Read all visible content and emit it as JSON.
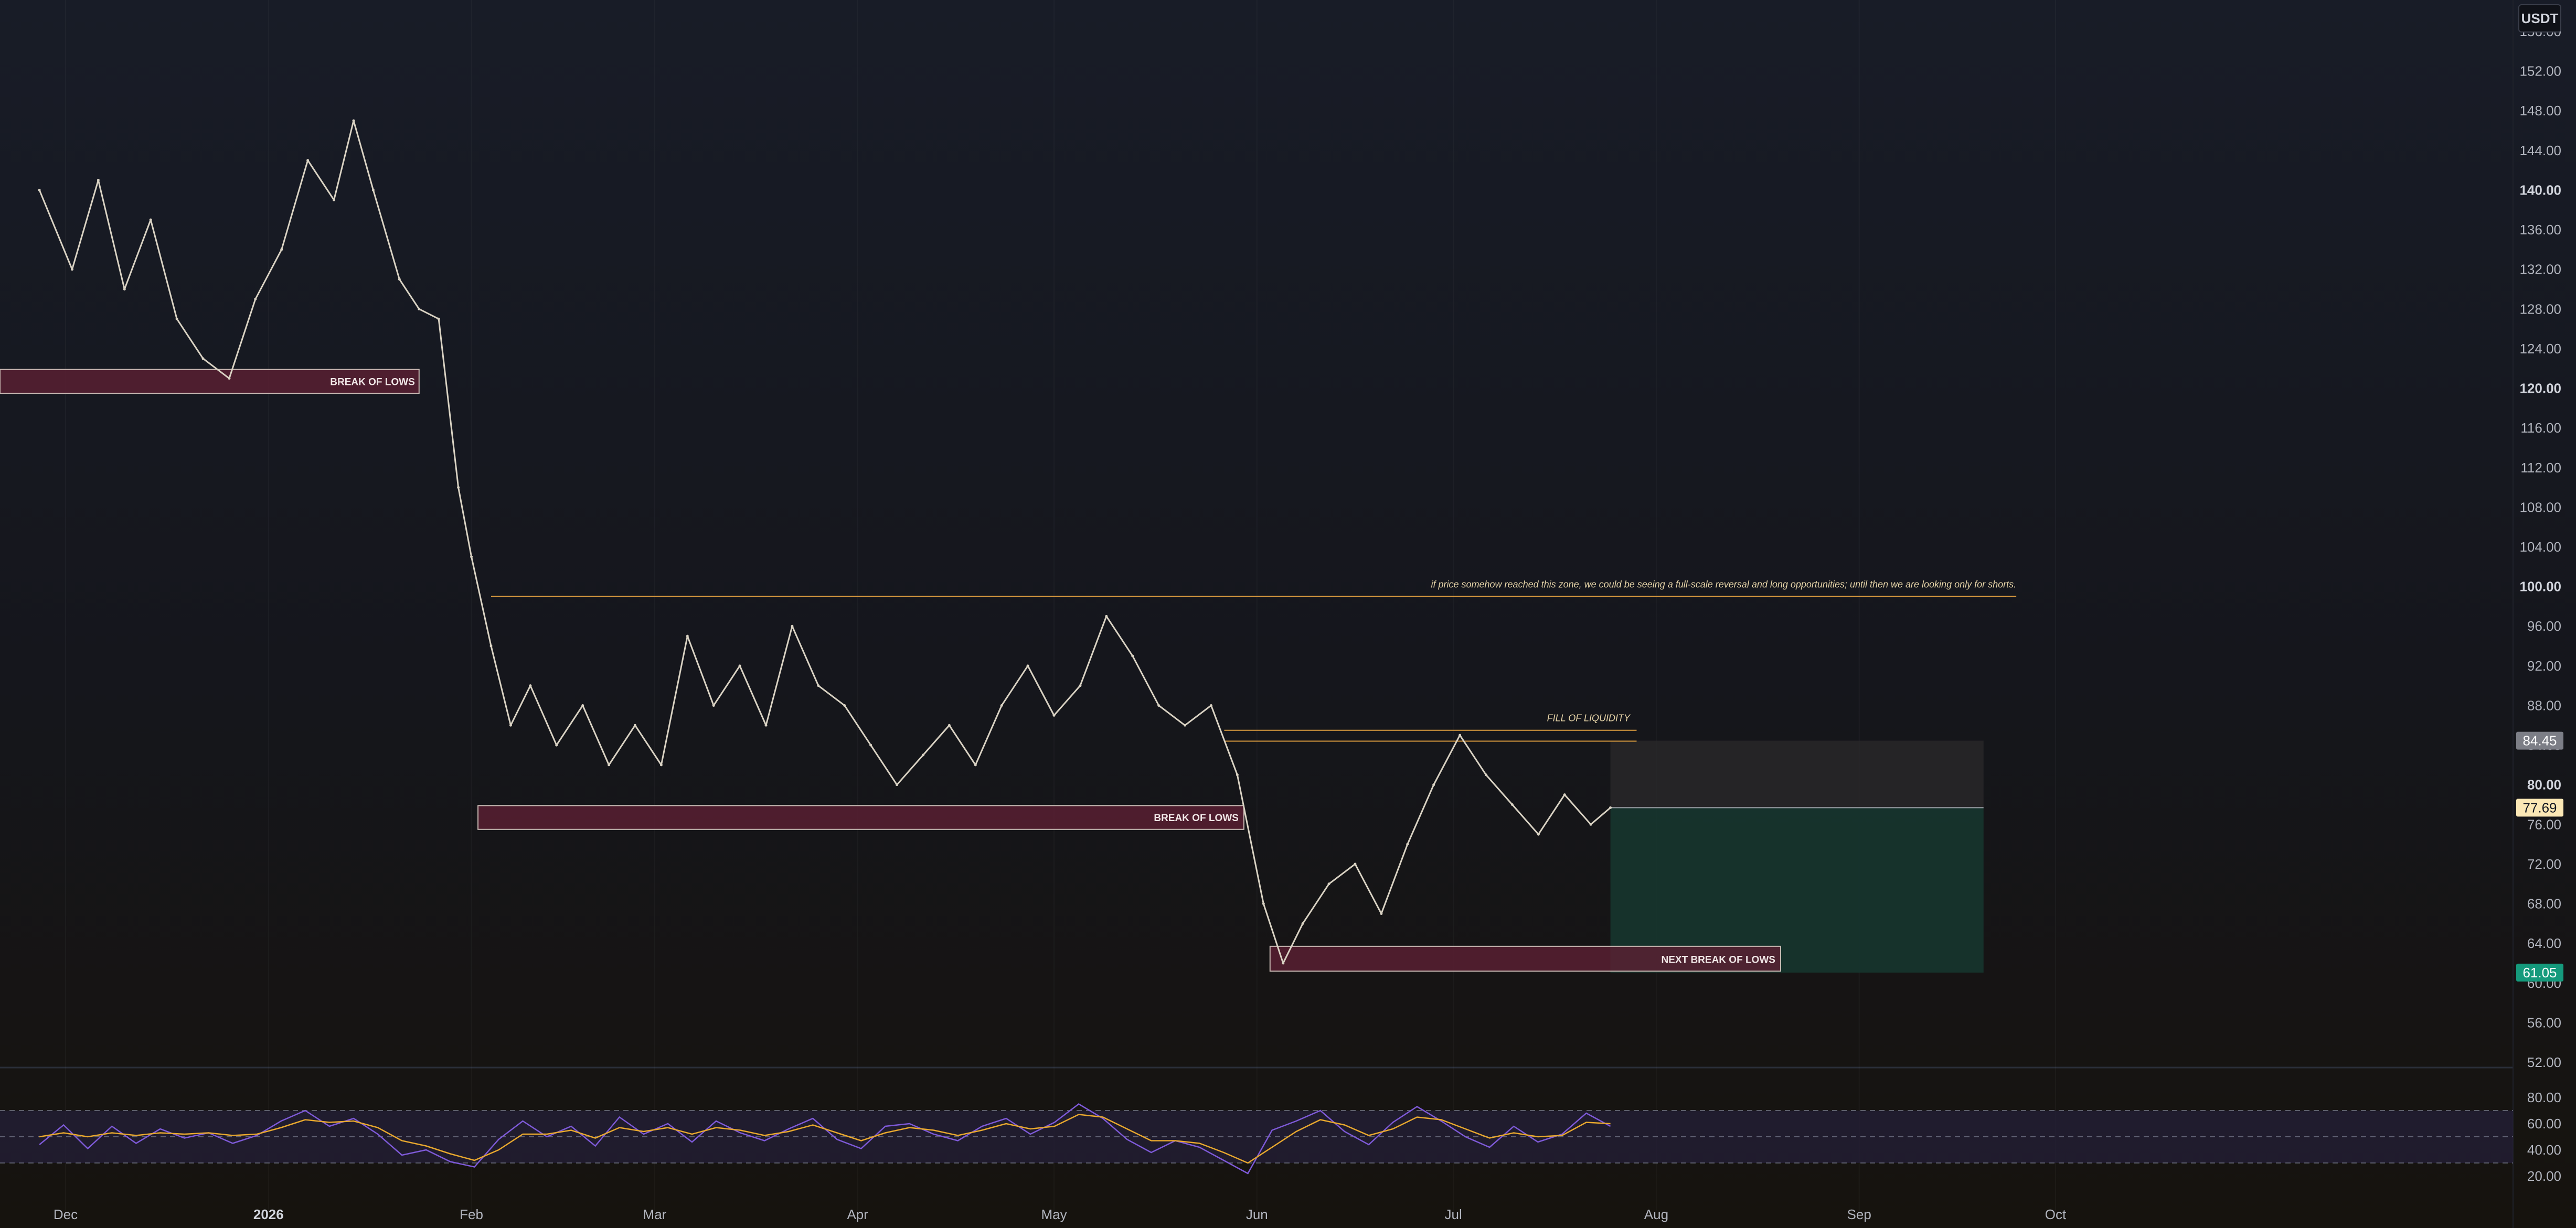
{
  "currency": {
    "label": "USDT"
  },
  "colors": {
    "price_line": "#d9d2c3",
    "zone_fill": "#5c1f33",
    "zone_border": "#c8b9b3",
    "level_line": "#d99a3e",
    "annotation_text": "#e6d4a8",
    "reward_fill": "#173a31",
    "risk_fill": "#2b2a2b",
    "rsi_line": "#7e5ad8",
    "rsi_ma": "#e8a82e",
    "rsi_band": "#251f3a",
    "axis_text": "#b2b5be",
    "last_price_bg": "#fbe7b5",
    "target_bg": "#159a7c",
    "stop_bg": "#7c7e86"
  },
  "chart_data": {
    "type": "line",
    "y_axis": {
      "ticks": [
        "52.00",
        "56.00",
        "60.00",
        "64.00",
        "68.00",
        "72.00",
        "76.00",
        "80.00",
        "84.00",
        "88.00",
        "92.00",
        "96.00",
        "100.00",
        "104.00",
        "108.00",
        "112.00",
        "116.00",
        "120.00",
        "124.00",
        "128.00",
        "132.00",
        "136.00",
        "140.00",
        "144.00",
        "148.00",
        "152.00",
        "156.00"
      ],
      "bold_ticks": [
        "80.00",
        "100.00",
        "120.00",
        "140.00"
      ],
      "range": [
        52,
        156
      ]
    },
    "x_axis": {
      "labels": [
        "Dec",
        "2026",
        "Feb",
        "Mar",
        "Apr",
        "May",
        "Jun",
        "Jul",
        "Aug",
        "Sep",
        "Oct"
      ],
      "bold_labels": [
        "2026"
      ]
    },
    "series": [
      {
        "x": [
          "2025-11-27",
          "2025-12-02",
          "2025-12-06",
          "2025-12-10",
          "2025-12-14",
          "2025-12-18",
          "2025-12-22",
          "2025-12-26",
          "2025-12-30",
          "2026-01-03",
          "2026-01-07",
          "2026-01-11",
          "2026-01-14",
          "2026-01-17",
          "2026-01-21",
          "2026-01-24",
          "2026-01-27",
          "2026-01-30",
          "2026-02-01",
          "2026-02-04",
          "2026-02-07",
          "2026-02-10",
          "2026-02-14",
          "2026-02-18",
          "2026-02-22",
          "2026-02-26",
          "2026-03-02",
          "2026-03-06",
          "2026-03-10",
          "2026-03-14",
          "2026-03-18",
          "2026-03-22",
          "2026-03-26",
          "2026-03-30",
          "2026-04-03",
          "2026-04-07",
          "2026-04-11",
          "2026-04-15",
          "2026-04-19",
          "2026-04-23",
          "2026-04-27",
          "2026-05-01",
          "2026-05-05",
          "2026-05-09",
          "2026-05-13",
          "2026-05-17",
          "2026-05-21",
          "2026-05-25",
          "2026-05-29",
          "2026-06-02",
          "2026-06-05",
          "2026-06-08",
          "2026-06-12",
          "2026-06-16",
          "2026-06-20",
          "2026-06-24",
          "2026-06-28",
          "2026-07-02",
          "2026-07-06",
          "2026-07-10",
          "2026-07-14",
          "2026-07-18",
          "2026-07-22",
          "2026-07-25"
        ],
        "values": [
          140,
          132,
          141,
          130,
          137,
          127,
          123,
          121,
          129,
          134,
          143,
          139,
          147,
          140,
          131,
          128,
          127,
          110,
          103,
          94,
          86,
          90,
          84,
          88,
          82,
          86,
          82,
          95,
          88,
          92,
          86,
          96,
          90,
          88,
          84,
          80,
          83,
          86,
          82,
          88,
          92,
          87,
          90,
          97,
          93,
          88,
          86,
          88,
          81,
          68,
          62,
          66,
          70,
          72,
          67,
          74,
          80,
          85,
          81,
          78,
          75,
          79,
          76,
          77.69
        ]
      }
    ],
    "rsi": {
      "ticks": [
        "20.00",
        "40.00",
        "60.00",
        "80.00"
      ],
      "bands": [
        30,
        50,
        70
      ],
      "values": [
        44,
        59,
        41,
        58,
        45,
        56,
        49,
        53,
        45,
        51,
        62,
        70,
        58,
        64,
        52,
        36,
        40,
        31,
        27,
        48,
        62,
        50,
        58,
        43,
        65,
        52,
        60,
        46,
        62,
        53,
        47,
        56,
        64,
        48,
        41,
        58,
        60,
        52,
        47,
        58,
        64,
        52,
        61,
        75,
        64,
        48,
        38,
        47,
        42,
        32,
        22,
        55,
        62,
        70,
        54,
        44,
        61,
        73,
        62,
        50,
        42,
        58,
        46,
        52,
        68,
        58
      ],
      "ma": [
        50,
        53,
        50,
        53,
        51,
        53,
        52,
        53,
        51,
        52,
        57,
        63,
        61,
        62,
        57,
        47,
        43,
        37,
        32,
        40,
        52,
        52,
        55,
        49,
        57,
        54,
        57,
        52,
        57,
        55,
        51,
        54,
        59,
        53,
        47,
        53,
        57,
        55,
        51,
        55,
        60,
        56,
        58,
        67,
        65,
        56,
        47,
        47,
        45,
        38,
        30,
        42,
        54,
        63,
        59,
        51,
        56,
        65,
        63,
        56,
        49,
        53,
        50,
        51,
        61,
        60
      ]
    },
    "annotations": {
      "zones": [
        "BREAK OF LOWS",
        "BREAK OF LOWS",
        "NEXT BREAK OF LOWS"
      ],
      "levels": [
        "if price somehow reached this zone, we could be seeing a full-scale reversal and long opportunities; until then we are looking only for shorts.",
        "FILL OF LIQUIDITY"
      ]
    },
    "price_labels": {
      "stop": "84.45",
      "last": "77.69",
      "target": "61.05"
    },
    "legend": "none",
    "grid": false
  }
}
